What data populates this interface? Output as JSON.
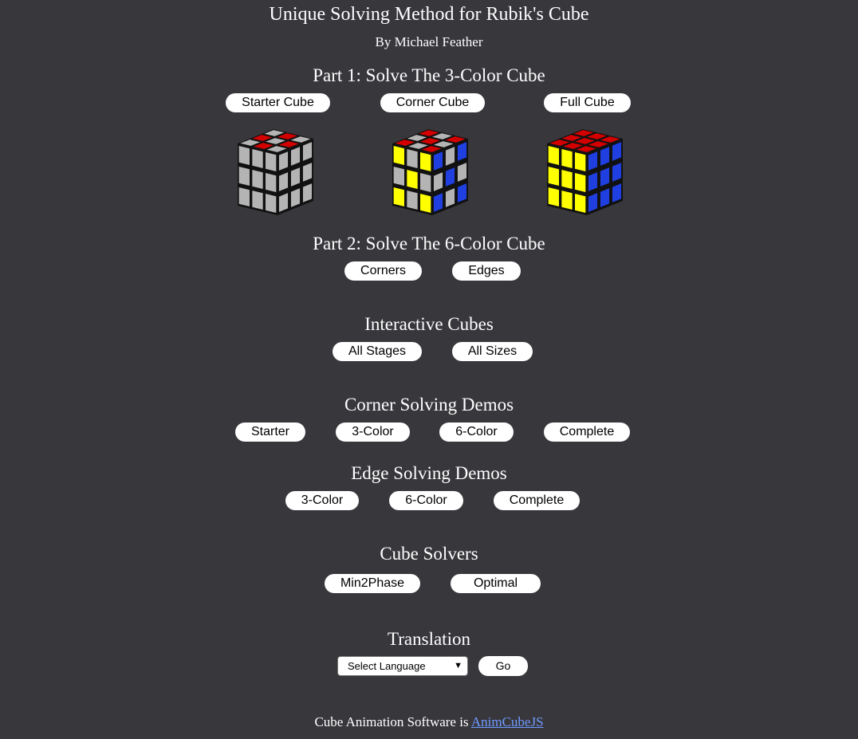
{
  "header": {
    "title": "Unique Solving Method for Rubik's Cube",
    "byline": "By Michael Feather"
  },
  "part1": {
    "heading": "Part 1: Solve The 3-Color Cube",
    "buttons": [
      "Starter Cube",
      "Corner Cube",
      "Full Cube"
    ]
  },
  "part2": {
    "heading": "Part 2: Solve The 6-Color Cube",
    "buttons": [
      "Corners",
      "Edges"
    ]
  },
  "interactive": {
    "heading": "Interactive Cubes",
    "buttons": [
      "All Stages",
      "All Sizes"
    ]
  },
  "corner_demos": {
    "heading": "Corner Solving Demos",
    "buttons": [
      "Starter",
      "3-Color",
      "6-Color",
      "Complete"
    ]
  },
  "edge_demos": {
    "heading": "Edge Solving Demos",
    "buttons": [
      "3-Color",
      "6-Color",
      "Complete"
    ]
  },
  "solvers": {
    "heading": "Cube Solvers",
    "buttons": [
      "Min2Phase",
      "Optimal"
    ]
  },
  "translation": {
    "heading": "Translation",
    "select_value": "Select Language",
    "go_label": "Go"
  },
  "footer": {
    "text": "Cube Animation Software is ",
    "link_text": "AnimCubeJS"
  },
  "colors": {
    "background": "#38373c",
    "red": "#d40000",
    "gray": "#b4b4b4",
    "yellow": "#ffff00",
    "blue": "#1f3fe0",
    "link": "#6f9bff"
  },
  "cubes": [
    {
      "name": "starter-cube",
      "top": [
        "gray",
        "red",
        "gray",
        "red",
        "gray",
        "red",
        "gray",
        "red",
        "gray"
      ],
      "front": [
        "gray",
        "gray",
        "gray",
        "gray",
        "gray",
        "gray",
        "gray",
        "gray",
        "gray"
      ],
      "right": [
        "gray",
        "gray",
        "gray",
        "gray",
        "gray",
        "gray",
        "gray",
        "gray",
        "gray"
      ]
    },
    {
      "name": "corner-cube",
      "top": [
        "red",
        "gray",
        "red",
        "gray",
        "red",
        "gray",
        "red",
        "gray",
        "red"
      ],
      "front": [
        "yellow",
        "gray",
        "yellow",
        "gray",
        "yellow",
        "gray",
        "yellow",
        "gray",
        "yellow"
      ],
      "right": [
        "blue",
        "gray",
        "blue",
        "gray",
        "blue",
        "gray",
        "blue",
        "gray",
        "blue"
      ]
    },
    {
      "name": "full-cube",
      "top": [
        "red",
        "red",
        "red",
        "red",
        "red",
        "red",
        "red",
        "red",
        "red"
      ],
      "front": [
        "yellow",
        "yellow",
        "yellow",
        "yellow",
        "yellow",
        "yellow",
        "yellow",
        "yellow",
        "yellow"
      ],
      "right": [
        "blue",
        "blue",
        "blue",
        "blue",
        "blue",
        "blue",
        "blue",
        "blue",
        "blue"
      ]
    }
  ]
}
